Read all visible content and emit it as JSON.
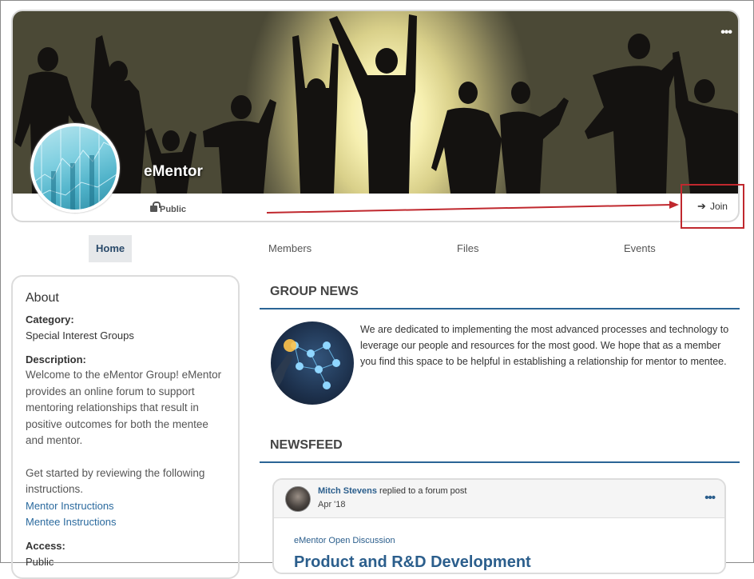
{
  "group": {
    "name": "eMentor",
    "visibility": "Public",
    "join_label": "Join",
    "more_icon": "ellipsis-icon"
  },
  "tabs": [
    {
      "label": "Home",
      "active": true
    },
    {
      "label": "Members",
      "active": false
    },
    {
      "label": "Files",
      "active": false
    },
    {
      "label": "Events",
      "active": false
    }
  ],
  "about": {
    "title": "About",
    "category_label": "Category:",
    "category_value": "Special Interest Groups",
    "description_label": "Description:",
    "description_p1": "Welcome to the eMentor Group! eMentor provides an online forum to support mentoring relationships that result in positive outcomes for both the mentee and mentor.",
    "description_p2": "Get started by reviewing the following instructions.",
    "links": [
      "Mentor Instructions",
      "Mentee Instructions"
    ],
    "access_label": "Access:",
    "access_value": "Public"
  },
  "group_news": {
    "title": "GROUP NEWS",
    "text": "We are dedicated to implementing the most advanced processes and technology to leverage our people and resources for the most good. We hope that as a member you find this space to be helpful in establishing a relationship for mentor to mentee."
  },
  "newsfeed": {
    "title": "NEWSFEED",
    "post": {
      "author": "Mitch Stevens",
      "action": "replied to a forum post",
      "date": "Apr '18",
      "group": "eMentor Open Discussion",
      "headline": "Product and R&D Development"
    }
  },
  "colors": {
    "accent": "#2a6496",
    "highlight_box": "#c0282e",
    "link": "#2b6a9e"
  }
}
